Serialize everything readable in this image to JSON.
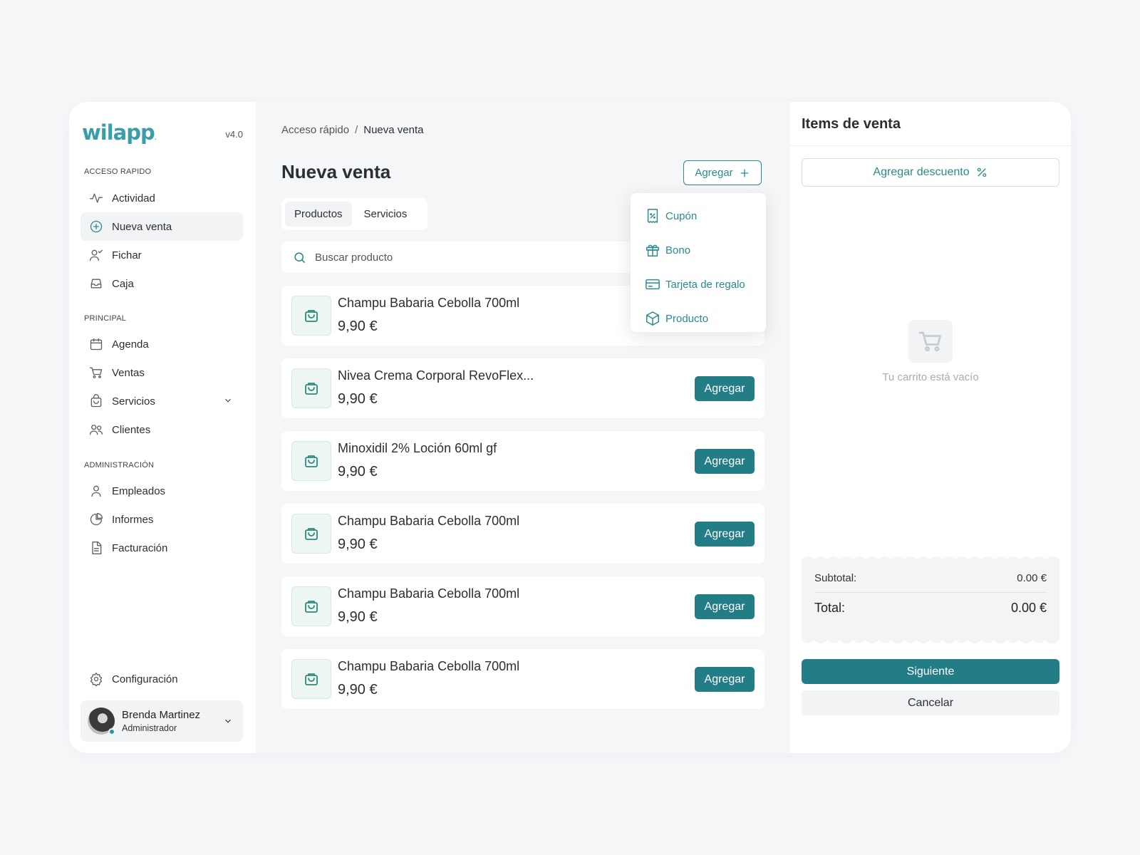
{
  "sidebar": {
    "logo": "wilapp",
    "version": "v4.0",
    "sections": {
      "quick": "ACCESO RAPIDO",
      "principal": "PRINCIPAL",
      "admin": "ADMINISTRACIÓN"
    },
    "items": [
      {
        "label": "Actividad",
        "icon": "activity-icon"
      },
      {
        "label": "Nueva venta",
        "icon": "plus-circle-icon",
        "active": true
      },
      {
        "label": "Fichar",
        "icon": "user-check-icon"
      },
      {
        "label": "Caja",
        "icon": "inbox-icon"
      },
      {
        "label": "Agenda",
        "icon": "calendar-icon"
      },
      {
        "label": "Ventas",
        "icon": "cart-icon"
      },
      {
        "label": "Servicios",
        "icon": "bag-icon"
      },
      {
        "label": "Clientes",
        "icon": "users-icon"
      },
      {
        "label": "Empleados",
        "icon": "user-icon"
      },
      {
        "label": "Informes",
        "icon": "pie-chart-icon"
      },
      {
        "label": "Facturación",
        "icon": "file-icon"
      }
    ],
    "settings": "Configuración",
    "user": {
      "name": "Brenda Martinez",
      "role": "Administrador"
    }
  },
  "main": {
    "breadcrumb": {
      "parent": "Acceso rápido",
      "separator": "/",
      "current": "Nueva venta"
    },
    "title": "Nueva venta",
    "add_button": "Agregar",
    "tabs": [
      "Productos",
      "Servicios"
    ],
    "search_placeholder": "Buscar producto",
    "dropdown": [
      "Cupón",
      "Bono",
      "Tarjeta de regalo",
      "Producto"
    ],
    "add_label": "Agregar",
    "products": [
      {
        "name": "Champu Babaria Cebolla 700ml",
        "price": "9,90 €"
      },
      {
        "name": "Nivea Crema Corporal RevoFlex...",
        "price": "9,90 €"
      },
      {
        "name": "Minoxidil 2% Loción 60ml gf",
        "price": "9,90 €"
      },
      {
        "name": "Champu Babaria Cebolla 700ml",
        "price": "9,90 €"
      },
      {
        "name": "Champu Babaria Cebolla 700ml",
        "price": "9,90 €"
      },
      {
        "name": "Champu Babaria Cebolla 700ml",
        "price": "9,90 €"
      }
    ]
  },
  "cart": {
    "title": "Items de venta",
    "discount_button": "Agregar descuento",
    "empty_text": "Tu carrito está vacío",
    "subtotal_label": "Subtotal:",
    "subtotal_value": "0.00 €",
    "total_label": "Total:",
    "total_value": "0.00 €",
    "next_button": "Siguiente",
    "cancel_button": "Cancelar"
  },
  "colors": {
    "accent": "#237d86",
    "brand": "#3a9ea8"
  }
}
